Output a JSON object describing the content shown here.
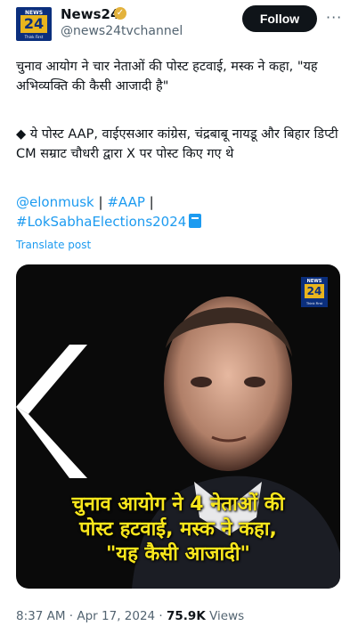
{
  "tweet": {
    "author_name": "News24",
    "handle": "@news24tvchannel",
    "follow_label": "Follow",
    "more_label": "···",
    "body_line1": "चुनाव आयोग ने चार नेताओं की पोस्ट हटवाई, मस्क ने कहा, \"यह  अभिव्यक्ति की कैसी आजादी है\"",
    "body_line2": "◆ ये पोस्ट AAP, वाईएसआर कांग्रेस, चंद्रबाबू नायडू और बिहार डिप्टी CM सम्राट चौधरी द्वारा X पर पोस्ट किए गए थे",
    "tags": [
      "@elonmusk",
      "#AAP",
      "#LokSabhaElections2024"
    ],
    "tag_separator": "|",
    "translate_label": "Translate post",
    "time": "8:37 AM",
    "date": "Apr 17, 2024",
    "views_count": "75.9K",
    "views_label": "Views"
  },
  "logo": {
    "top": "NEWS",
    "number": "24",
    "tagline": "Think First"
  },
  "media": {
    "headline_line1": "चुनाव आयोग ने 4 नेताओं की",
    "headline_line2": "पोस्ट हटवाई, मस्क ने कहा,",
    "headline_line3": "\"यह कैसी आजादी\""
  },
  "colors": {
    "link": "#1d9bf0",
    "follow_bg": "#0f1419",
    "headline": "#f8e61c",
    "brand_blue": "#0b2f7d",
    "brand_gold": "#e9b51d"
  }
}
